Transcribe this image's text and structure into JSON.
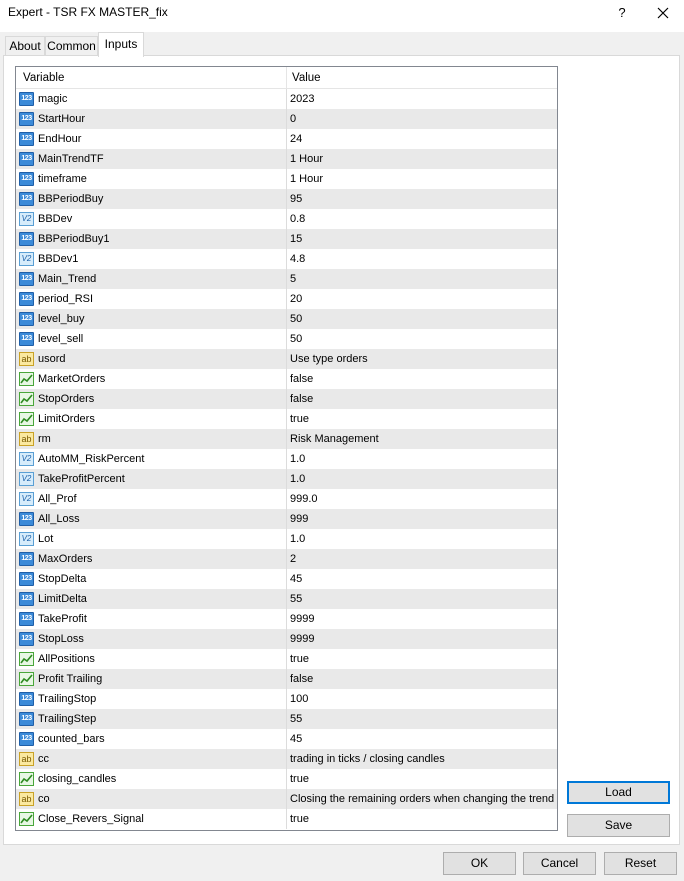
{
  "window": {
    "title": "Expert - TSR FX MASTER_fix",
    "help": "?",
    "close_icon": "close-icon"
  },
  "tabs": [
    {
      "label": "About"
    },
    {
      "label": "Common"
    },
    {
      "label": "Inputs",
      "active": true
    }
  ],
  "grid": {
    "columns": {
      "variable": "Variable",
      "value": "Value"
    },
    "rows": [
      {
        "type": "int",
        "name": "magic",
        "value": "2023"
      },
      {
        "type": "int",
        "name": "StartHour",
        "value": "0"
      },
      {
        "type": "int",
        "name": "EndHour",
        "value": "24"
      },
      {
        "type": "int",
        "name": "MainTrendTF",
        "value": "1 Hour"
      },
      {
        "type": "int",
        "name": "timeframe",
        "value": "1 Hour"
      },
      {
        "type": "int",
        "name": "BBPeriodBuy",
        "value": "95"
      },
      {
        "type": "dbl",
        "name": "BBDev",
        "value": "0.8"
      },
      {
        "type": "int",
        "name": "BBPeriodBuy1",
        "value": "15"
      },
      {
        "type": "dbl",
        "name": "BBDev1",
        "value": "4.8"
      },
      {
        "type": "int",
        "name": "Main_Trend",
        "value": "5"
      },
      {
        "type": "int",
        "name": "period_RSI",
        "value": "20"
      },
      {
        "type": "int",
        "name": "level_buy",
        "value": "50"
      },
      {
        "type": "int",
        "name": "level_sell",
        "value": "50"
      },
      {
        "type": "str",
        "name": "usord",
        "value": "Use type orders"
      },
      {
        "type": "bool",
        "name": "MarketOrders",
        "value": "false"
      },
      {
        "type": "bool",
        "name": "StopOrders",
        "value": "false"
      },
      {
        "type": "bool",
        "name": "LimitOrders",
        "value": "true"
      },
      {
        "type": "str",
        "name": "rm",
        "value": "Risk Management"
      },
      {
        "type": "dbl",
        "name": "AutoMM_RiskPercent",
        "value": "1.0"
      },
      {
        "type": "dbl",
        "name": "TakeProfitPercent",
        "value": "1.0"
      },
      {
        "type": "dbl",
        "name": "All_Prof",
        "value": "999.0"
      },
      {
        "type": "int",
        "name": "All_Loss",
        "value": "999"
      },
      {
        "type": "dbl",
        "name": "Lot",
        "value": "1.0"
      },
      {
        "type": "int",
        "name": "MaxOrders",
        "value": "2"
      },
      {
        "type": "int",
        "name": "StopDelta",
        "value": "45"
      },
      {
        "type": "int",
        "name": "LimitDelta",
        "value": "55"
      },
      {
        "type": "int",
        "name": "TakeProfit",
        "value": "9999"
      },
      {
        "type": "int",
        "name": "StopLoss",
        "value": "9999"
      },
      {
        "type": "bool",
        "name": "AllPositions",
        "value": "true"
      },
      {
        "type": "bool",
        "name": "Profit Trailing",
        "value": "false"
      },
      {
        "type": "int",
        "name": "TrailingStop",
        "value": "100"
      },
      {
        "type": "int",
        "name": "TrailingStep",
        "value": "55"
      },
      {
        "type": "int",
        "name": "counted_bars",
        "value": "45"
      },
      {
        "type": "str",
        "name": "cc",
        "value": "trading in ticks / closing candles"
      },
      {
        "type": "bool",
        "name": "closing_candles",
        "value": "true"
      },
      {
        "type": "str",
        "name": "co",
        "value": "Closing the remaining orders when changing the trend"
      },
      {
        "type": "bool",
        "name": "Close_Revers_Signal",
        "value": "true"
      }
    ]
  },
  "icon_text": {
    "int": "123",
    "dbl": "V2",
    "str": "ab"
  },
  "side_buttons": {
    "load": "Load",
    "save": "Save"
  },
  "footer_buttons": {
    "ok": "OK",
    "cancel": "Cancel",
    "reset": "Reset"
  }
}
